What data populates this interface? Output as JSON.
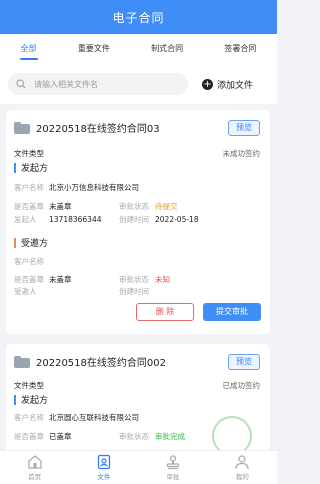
{
  "header": {
    "title": "电子合同"
  },
  "tabs": [
    {
      "label": "全部"
    },
    {
      "label": "重要文件"
    },
    {
      "label": "制式合同"
    },
    {
      "label": "签署合同"
    }
  ],
  "search": {
    "placeholder": "请输入相关文件名",
    "add_label": "添加文件"
  },
  "cards": [
    {
      "title": "20220518在线签约合同03",
      "preview": "预览",
      "file_type_label": "文件类型",
      "sign_status": "未成功签约",
      "initiator": {
        "section_title": "发起方",
        "customer_label": "客户名称",
        "customer_name": "北京小万信息科技有限公司",
        "stamp_label": "是否盖章",
        "stamp_value": "未盖章",
        "approval_label": "审批状态",
        "approval_value": "待提交",
        "initiator_label": "发起人",
        "phone": "13718366344",
        "created_label": "创建时间",
        "created_value": "2022-05-18"
      },
      "recipient": {
        "section_title": "受邀方",
        "customer_label": "客户名称",
        "stamp_label": "是否盖章",
        "stamp_value": "未盖章",
        "approval_label": "审批状态",
        "approval_value": "未知",
        "invitee_label": "受邀人",
        "created_label": "创建时间"
      },
      "delete_label": "删 除",
      "submit_label": "提交审批"
    },
    {
      "title": "20220518在线签约合同002",
      "preview": "预览",
      "file_type_label": "文件类型",
      "sign_status": "已成功签约",
      "initiator": {
        "section_title": "发起方",
        "customer_label": "客户名称",
        "customer_name": "北京圆心互联科技有限公司",
        "stamp_label": "是否盖章",
        "stamp_value": "已盖章",
        "approval_label": "审批状态",
        "approval_value": "审批完成"
      }
    }
  ],
  "nav": [
    {
      "label": "首页"
    },
    {
      "label": "文件"
    },
    {
      "label": "审批"
    },
    {
      "label": "我的"
    }
  ],
  "colors": {
    "primary": "#3f8ef7",
    "danger": "#e05050",
    "warning": "#e0a020",
    "success": "#3cb34a"
  }
}
